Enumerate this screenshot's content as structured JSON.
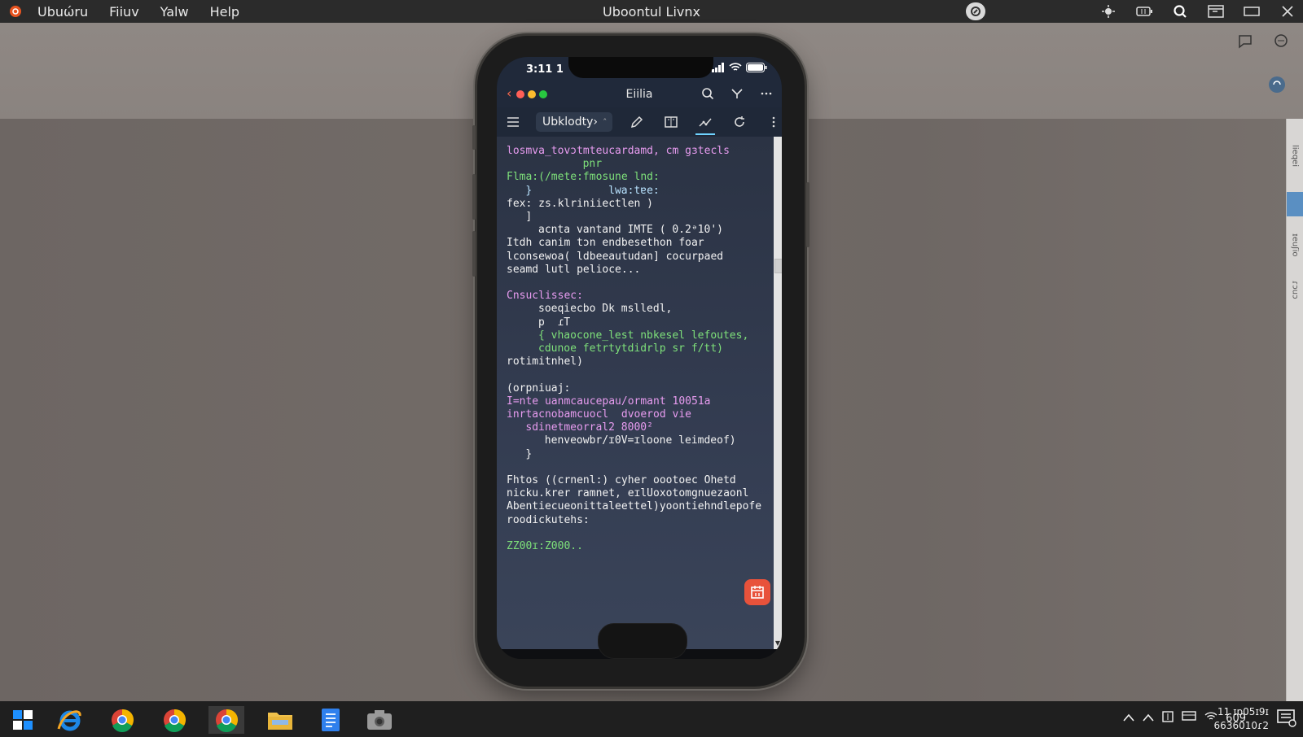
{
  "topbar": {
    "menu": [
      "Ubuώru",
      "Fiiuv",
      "Yalw",
      "Help"
    ],
    "title": "Uboontul Livnx"
  },
  "phone": {
    "status_time": "3:11 1",
    "app_title": "Eiilia",
    "tab_label": "Ubklodty›",
    "tab_caret": "ˆ",
    "editor_lines": [
      {
        "text": "losmva_tovɔtmteucardamd, cm gɜtecls",
        "color": "#e89cf0",
        "indent": 0
      },
      {
        "text": "pnr",
        "color": "#7ee07a",
        "indent": 12
      },
      {
        "text": "Flma:(/mete:fmosune lnd:",
        "color": "#7ee07a",
        "indent": 0
      },
      {
        "text": "}            lwa:tɐe:",
        "color": "#b9e3ff",
        "indent": 3
      },
      {
        "text": "fex: zs.klriniiectlen )",
        "color": "#f2f2f2",
        "indent": 0
      },
      {
        "text": "]",
        "color": "#f2f2f2",
        "indent": 3
      },
      {
        "text": "acnta vantand IMTE ( 0.2ᵊ10')",
        "color": "#f2f2f2",
        "indent": 5
      },
      {
        "text": "Itdh canim tɔn endbesethon foar",
        "color": "#f2f2f2",
        "indent": 0
      },
      {
        "text": "lconsewoa( ldbeeautudan] cocurpaed",
        "color": "#f2f2f2",
        "indent": 0
      },
      {
        "text": "seamd lutl pelioce...",
        "color": "#f2f2f2",
        "indent": 0
      },
      {
        "text": "",
        "color": "#f2f2f2",
        "indent": 0
      },
      {
        "text": "Cnsuclissec:",
        "color": "#e89cf0",
        "indent": 0
      },
      {
        "text": "soeqiecbo Dk mslledl,",
        "color": "#f2f2f2",
        "indent": 5
      },
      {
        "text": "p  ɾT",
        "color": "#f2f2f2",
        "indent": 5
      },
      {
        "text": "{ vhaocone_lest nbkesel lefoutes,",
        "color": "#7ee07a",
        "indent": 5
      },
      {
        "text": "cdunoe fetrtytdidrlp sr f/tt)",
        "color": "#7ee07a",
        "indent": 5
      },
      {
        "text": "rotimitnhel)",
        "color": "#f2f2f2",
        "indent": 0
      },
      {
        "text": "",
        "color": "#f2f2f2",
        "indent": 0
      },
      {
        "text": "(orpniuaj:",
        "color": "#f2f2f2",
        "indent": 0
      },
      {
        "text": "I=nte uanmcaucepau/ormant 10051a",
        "color": "#e89cf0",
        "indent": 0
      },
      {
        "text": "inrtacnobamcuocl  dvoerod vie",
        "color": "#e89cf0",
        "indent": 0
      },
      {
        "text": "sdinetmeorral2 8000²",
        "color": "#e89cf0",
        "indent": 3
      },
      {
        "text": "henveowbr/ɪ0V=ɪloone leimdeof)",
        "color": "#f2f2f2",
        "indent": 6
      },
      {
        "text": "}",
        "color": "#f2f2f2",
        "indent": 3
      },
      {
        "text": "",
        "color": "#f2f2f2",
        "indent": 0
      },
      {
        "text": "Fhtos ((crnenl:) cyher oootoec Ohetd",
        "color": "#f2f2f2",
        "indent": 0
      },
      {
        "text": "nicku.krer ramnet, eɪlUoxotomgnuezaonl",
        "color": "#f2f2f2",
        "indent": 0
      },
      {
        "text": "Abentiecueonittaleettel)yoontiehndlepofe",
        "color": "#f2f2f2",
        "indent": 0
      },
      {
        "text": "roodickutehs:",
        "color": "#f2f2f2",
        "indent": 0
      },
      {
        "text": "",
        "color": "#f2f2f2",
        "indent": 0
      },
      {
        "text": "ZZ00ɪ:Z000..",
        "color": "#7ee07a",
        "indent": 0
      }
    ]
  },
  "right_scroll": {
    "tabs": [
      "lieqei",
      "ɪeuʃio",
      "ɾɔuɔ"
    ]
  },
  "taskbar": {
    "clock_time": "11 ɪɒ05ɪ9ɪ",
    "clock_date": "6636010ɾ2",
    "network": "609"
  },
  "colors": {
    "accent": "#6fd3ff",
    "fab": "#e8523b",
    "traffic_red": "#ff5f57",
    "traffic_yellow": "#febc2e",
    "traffic_green": "#28c840"
  }
}
